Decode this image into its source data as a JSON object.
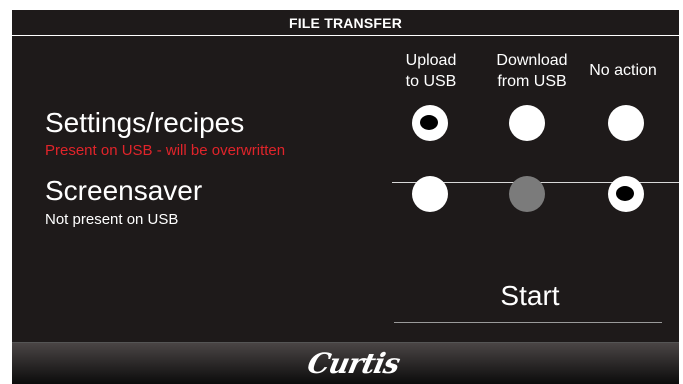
{
  "header": {
    "title": "FILE TRANSFER"
  },
  "columns": {
    "upload": "Upload\nto USB",
    "download": "Download\nfrom USB",
    "no_action": "No action"
  },
  "rows": [
    {
      "title": "Settings/recipes",
      "status": "Present on USB - will be overwritten",
      "status_color": "#e0242a",
      "selected": "upload"
    },
    {
      "title": "Screensaver",
      "status": "Not present on USB",
      "status_color": "#ffffff",
      "selected": "no_action",
      "download_disabled": true
    }
  ],
  "start_label": "Start",
  "logo_text": "Curtis",
  "colors": {
    "background": "#1e1a1a",
    "radio": "#ffffff",
    "radio_disabled": "#7b7b7b",
    "warning": "#e0242a"
  }
}
